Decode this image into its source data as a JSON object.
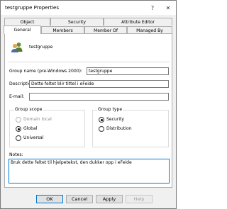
{
  "window": {
    "title": "testgruppe Properties",
    "help_glyph": "?",
    "close_glyph": "✕"
  },
  "tabs": {
    "row1": [
      {
        "label": "Object"
      },
      {
        "label": "Security"
      },
      {
        "label": "Attribute Editor"
      }
    ],
    "row2": [
      {
        "label": "General"
      },
      {
        "label": "Members"
      },
      {
        "label": "Member Of"
      },
      {
        "label": "Managed By"
      }
    ],
    "active": "General"
  },
  "general": {
    "icon": "group-users-icon",
    "name": "testgruppe",
    "group_name_label": "Group name (pre-Windows 2000):",
    "group_name_value": "testgruppe",
    "description_label": "Description:",
    "description_value": "Dette feltet blir tittel i eFeide",
    "email_label": "E-mail:",
    "email_value": "",
    "group_scope": {
      "label": "Group scope",
      "options": [
        {
          "label": "Domain local",
          "selected": false,
          "disabled": true
        },
        {
          "label": "Global",
          "selected": true,
          "disabled": false
        },
        {
          "label": "Universal",
          "selected": false,
          "disabled": false
        }
      ]
    },
    "group_type": {
      "label": "Group type",
      "options": [
        {
          "label": "Security",
          "selected": true
        },
        {
          "label": "Distribution",
          "selected": false
        }
      ]
    },
    "notes_label": "Notes:",
    "notes_value": "Bruk dette feltet til hjelpetekst, den dukker opp i eFeide"
  },
  "buttons": {
    "ok": "OK",
    "cancel": "Cancel",
    "apply": "Apply",
    "help": "Help"
  },
  "colors": {
    "focus": "#0078d7",
    "window_bg": "#f0f0f0"
  }
}
